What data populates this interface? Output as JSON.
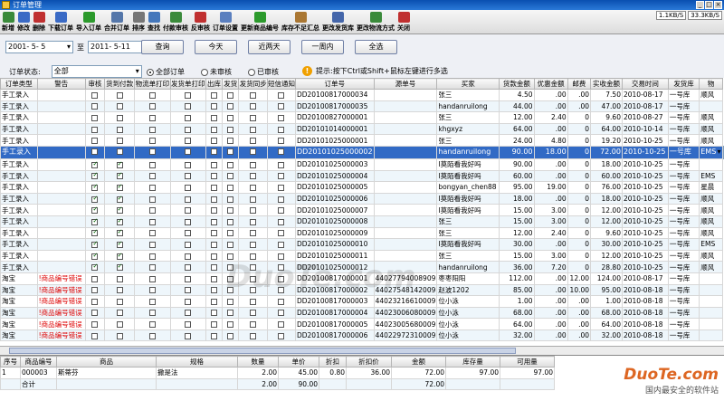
{
  "window": {
    "title": "订单管理"
  },
  "speed": {
    "up": "1.1KB/S",
    "down": "33.3KB/S"
  },
  "toolbar": [
    {
      "label": "新增",
      "icon": "new-icon",
      "color": "#3a8a3a"
    },
    {
      "label": "修改",
      "icon": "edit-icon",
      "color": "#3a6ac5"
    },
    {
      "label": "删除",
      "icon": "delete-icon",
      "color": "#c03030"
    },
    {
      "label": "下载订单",
      "icon": "download-icon",
      "color": "#3a6ac5"
    },
    {
      "label": "导入订单",
      "icon": "import-icon",
      "color": "#2c9a2c"
    },
    {
      "label": "合并订单",
      "icon": "merge-icon",
      "color": "#5577aa"
    },
    {
      "label": "排序",
      "icon": "sort-icon",
      "color": "#777777"
    },
    {
      "label": "查找",
      "icon": "search-icon",
      "color": "#4477bb"
    },
    {
      "label": "付款审核",
      "icon": "pay-audit-icon",
      "color": "#3a8a3a"
    },
    {
      "label": "反审核",
      "icon": "unaudit-icon",
      "color": "#c03030"
    },
    {
      "label": "订单设置",
      "icon": "settings-icon",
      "color": "#5a7fbf"
    },
    {
      "label": "更新商品编号",
      "icon": "update-icon",
      "color": "#2c9a2c"
    },
    {
      "label": "库存不足汇总",
      "icon": "stock-icon",
      "color": "#aa7733"
    },
    {
      "label": "更改发货库",
      "icon": "warehouse-icon",
      "color": "#4466aa"
    },
    {
      "label": "更改物流方式",
      "icon": "logistics-icon",
      "color": "#3a8a3a"
    },
    {
      "label": "关闭",
      "icon": "close-icon",
      "color": "#c03030"
    }
  ],
  "filter": {
    "date_from": "2001- 5- 5",
    "to_label": "至",
    "date_to": "2011- 5-11",
    "buttons": [
      "查询",
      "今天",
      "近两天",
      "一周内",
      "全选"
    ],
    "status_label": "订单状态:",
    "status_value": "全部",
    "radios": [
      {
        "label": "全部订单",
        "checked": true
      },
      {
        "label": "未审核",
        "checked": false
      },
      {
        "label": "已审核",
        "checked": false
      }
    ],
    "hint": "提示:按下Ctrl或Shift+鼠标左键进行多选"
  },
  "grid": {
    "columns": [
      "订单类型",
      "警告",
      "审核",
      "货到付款",
      "物流单打印",
      "发货单打印",
      "出库",
      "发货",
      "发货同步",
      "短信通知",
      "订单号",
      "源单号",
      "买家",
      "货款金额",
      "优惠金额",
      "邮费",
      "实收金额",
      "交易时间",
      "发货库",
      "物"
    ],
    "rows": [
      {
        "type": "手工录入",
        "warn": "",
        "chk": [
          0,
          0,
          0,
          0,
          0,
          0,
          0,
          0
        ],
        "order": "DD20100817000034",
        "src": "",
        "buyer": "张三",
        "amt": "4.50",
        "disc": ".00",
        "post": ".00",
        "real": "7.50",
        "time": "2010-08-17",
        "wh": "一号库",
        "lg": "顺风"
      },
      {
        "type": "手工录入",
        "warn": "",
        "chk": [
          0,
          0,
          0,
          0,
          0,
          0,
          0,
          0
        ],
        "order": "DD20100817000035",
        "src": "",
        "buyer": "handanruilong",
        "amt": "44.00",
        "disc": ".00",
        "post": ".00",
        "real": "47.00",
        "time": "2010-08-17",
        "wh": "一号库",
        "lg": ""
      },
      {
        "type": "手工录入",
        "warn": "",
        "chk": [
          0,
          0,
          0,
          0,
          0,
          0,
          0,
          0
        ],
        "order": "DD20100827000001",
        "src": "",
        "buyer": "张三",
        "amt": "12.00",
        "disc": "2.40",
        "post": "0",
        "real": "9.60",
        "time": "2010-08-27",
        "wh": "一号库",
        "lg": "顺风"
      },
      {
        "type": "手工录入",
        "warn": "",
        "chk": [
          0,
          0,
          0,
          0,
          0,
          0,
          0,
          0
        ],
        "order": "DD20101014000001",
        "src": "",
        "buyer": "khgxyz",
        "amt": "64.00",
        "disc": ".00",
        "post": "0",
        "real": "64.00",
        "time": "2010-10-14",
        "wh": "一号库",
        "lg": "顺风"
      },
      {
        "type": "手工录入",
        "warn": "",
        "chk": [
          0,
          0,
          0,
          0,
          0,
          0,
          0,
          0
        ],
        "order": "DD20101025000001",
        "src": "",
        "buyer": "张三",
        "amt": "24.00",
        "disc": "4.80",
        "post": "0",
        "real": "19.20",
        "time": "2010-10-25",
        "wh": "一号库",
        "lg": "顺风"
      },
      {
        "type": "手工录入",
        "warn": "",
        "chk": [
          0,
          0,
          0,
          0,
          0,
          0,
          0,
          0
        ],
        "order": "DD20101025000002",
        "src": "",
        "buyer": "handanruilong",
        "amt": "90.00",
        "disc": "18.00",
        "post": "0",
        "real": "72.00",
        "time": "2010-10-25",
        "wh": "一号库",
        "lg": "EMS",
        "sel": true
      },
      {
        "type": "手工录入",
        "warn": "",
        "chk": [
          1,
          1,
          0,
          0,
          0,
          0,
          0,
          0
        ],
        "order": "DD20101025000003",
        "src": "",
        "buyer": "I莫陌看我好吗",
        "amt": "90.00",
        "disc": ".00",
        "post": "0",
        "real": "18.00",
        "time": "2010-10-25",
        "wh": "一号库",
        "lg": ""
      },
      {
        "type": "手工录入",
        "warn": "",
        "chk": [
          1,
          1,
          0,
          0,
          0,
          0,
          0,
          0
        ],
        "order": "DD20101025000004",
        "src": "",
        "buyer": "I莫陌看我好吗",
        "amt": "60.00",
        "disc": ".00",
        "post": "0",
        "real": "60.00",
        "time": "2010-10-25",
        "wh": "一号库",
        "lg": "EMS"
      },
      {
        "type": "手工录入",
        "warn": "",
        "chk": [
          1,
          1,
          0,
          0,
          0,
          0,
          0,
          0
        ],
        "order": "DD20101025000005",
        "src": "",
        "buyer": "bongyan_chen88",
        "amt": "95.00",
        "disc": "19.00",
        "post": "0",
        "real": "76.00",
        "time": "2010-10-25",
        "wh": "一号库",
        "lg": "星晨"
      },
      {
        "type": "手工录入",
        "warn": "",
        "chk": [
          1,
          1,
          0,
          0,
          0,
          0,
          0,
          0
        ],
        "order": "DD20101025000006",
        "src": "",
        "buyer": "I莫陌看我好吗",
        "amt": "18.00",
        "disc": ".00",
        "post": "0",
        "real": "18.00",
        "time": "2010-10-25",
        "wh": "一号库",
        "lg": "顺风"
      },
      {
        "type": "手工录入",
        "warn": "",
        "chk": [
          1,
          1,
          0,
          0,
          0,
          0,
          0,
          0
        ],
        "order": "DD20101025000007",
        "src": "",
        "buyer": "I莫陌看我好吗",
        "amt": "15.00",
        "disc": "3.00",
        "post": "0",
        "real": "12.00",
        "time": "2010-10-25",
        "wh": "一号库",
        "lg": "顺风"
      },
      {
        "type": "手工录入",
        "warn": "",
        "chk": [
          1,
          1,
          0,
          0,
          0,
          0,
          0,
          0
        ],
        "order": "DD20101025000008",
        "src": "",
        "buyer": "张三",
        "amt": "15.00",
        "disc": "3.00",
        "post": "0",
        "real": "12.00",
        "time": "2010-10-25",
        "wh": "一号库",
        "lg": "顺风"
      },
      {
        "type": "手工录入",
        "warn": "",
        "chk": [
          1,
          1,
          0,
          0,
          0,
          0,
          0,
          0
        ],
        "order": "DD20101025000009",
        "src": "",
        "buyer": "张三",
        "amt": "12.00",
        "disc": "2.40",
        "post": "0",
        "real": "9.60",
        "time": "2010-10-25",
        "wh": "一号库",
        "lg": "顺风"
      },
      {
        "type": "手工录入",
        "warn": "",
        "chk": [
          1,
          1,
          0,
          0,
          0,
          0,
          0,
          0
        ],
        "order": "DD20101025000010",
        "src": "",
        "buyer": "I莫陌看我好吗",
        "amt": "30.00",
        "disc": ".00",
        "post": "0",
        "real": "30.00",
        "time": "2010-10-25",
        "wh": "一号库",
        "lg": "EMS"
      },
      {
        "type": "手工录入",
        "warn": "",
        "chk": [
          1,
          1,
          0,
          0,
          0,
          0,
          0,
          0
        ],
        "order": "DD20101025000011",
        "src": "",
        "buyer": "张三",
        "amt": "15.00",
        "disc": "3.00",
        "post": "0",
        "real": "12.00",
        "time": "2010-10-25",
        "wh": "一号库",
        "lg": "顺风"
      },
      {
        "type": "手工录入",
        "warn": "",
        "chk": [
          1,
          1,
          0,
          0,
          0,
          0,
          0,
          0
        ],
        "order": "DD20101025000012",
        "src": "",
        "buyer": "handanruilong",
        "amt": "36.00",
        "disc": "7.20",
        "post": "0",
        "real": "28.80",
        "time": "2010-10-25",
        "wh": "一号库",
        "lg": "顺风"
      },
      {
        "type": "淘宝",
        "warn": "!商品编号错误",
        "chk": [
          0,
          0,
          0,
          0,
          0,
          0,
          0,
          0
        ],
        "order": "DD20100817000001",
        "src": "44027794008909",
        "buyer": "枣枣阳阳",
        "amt": "112.00",
        "disc": ".00",
        "post": "12.00",
        "real": "124.00",
        "time": "2010-08-17",
        "wh": "一号库",
        "lg": ""
      },
      {
        "type": "淘宝",
        "warn": "!商品编号错误",
        "chk": [
          0,
          0,
          0,
          0,
          0,
          0,
          0,
          0
        ],
        "order": "DD20100817000002",
        "src": "44027548142009",
        "buyer": "赵波1202",
        "amt": "85.00",
        "disc": ".00",
        "post": "10.00",
        "real": "95.00",
        "time": "2010-08-18",
        "wh": "一号库",
        "lg": ""
      },
      {
        "type": "淘宝",
        "warn": "!商品编号错误",
        "chk": [
          0,
          0,
          0,
          0,
          0,
          0,
          0,
          0
        ],
        "order": "DD20100817000003",
        "src": "44023216610009",
        "buyer": "位小泳",
        "amt": "1.00",
        "disc": ".00",
        "post": ".00",
        "real": "1.00",
        "time": "2010-08-18",
        "wh": "一号库",
        "lg": ""
      },
      {
        "type": "淘宝",
        "warn": "!商品编号错误",
        "chk": [
          0,
          0,
          0,
          0,
          0,
          0,
          0,
          0
        ],
        "order": "DD20100817000004",
        "src": "44023006080009",
        "buyer": "位小泳",
        "amt": "68.00",
        "disc": ".00",
        "post": ".00",
        "real": "68.00",
        "time": "2010-08-18",
        "wh": "一号库",
        "lg": ""
      },
      {
        "type": "淘宝",
        "warn": "!商品编号错误",
        "chk": [
          0,
          0,
          0,
          0,
          0,
          0,
          0,
          0
        ],
        "order": "DD20100817000005",
        "src": "44023005680009",
        "buyer": "位小泳",
        "amt": "64.00",
        "disc": ".00",
        "post": ".00",
        "real": "64.00",
        "time": "2010-08-18",
        "wh": "一号库",
        "lg": ""
      },
      {
        "type": "淘宝",
        "warn": "!商品编号错误",
        "chk": [
          0,
          0,
          0,
          0,
          0,
          0,
          0,
          0
        ],
        "order": "DD20100817000006",
        "src": "44022972310009",
        "buyer": "位小泳",
        "amt": "32.00",
        "disc": ".00",
        "post": ".00",
        "real": "32.00",
        "time": "2010-08-18",
        "wh": "一号库",
        "lg": ""
      }
    ]
  },
  "detail": {
    "columns": [
      "序号",
      "商品编号",
      "商品",
      "规格",
      "数量",
      "单价",
      "折扣",
      "折扣价",
      "金额",
      "库存量",
      "可用量"
    ],
    "row": [
      "1",
      "000003",
      "斯蒂芬",
      "撒是法",
      "2.00",
      "45.00",
      "0.80",
      "36.00",
      "72.00",
      "97.00",
      "97.00"
    ],
    "total": {
      "label": "合计",
      "qty": "2.00",
      "price": "90.00",
      "amount": "72.00"
    }
  },
  "watermark": "DuoTe.com",
  "logo": {
    "brand": "DuoTe.com",
    "tag": "国内最安全的软件站"
  }
}
